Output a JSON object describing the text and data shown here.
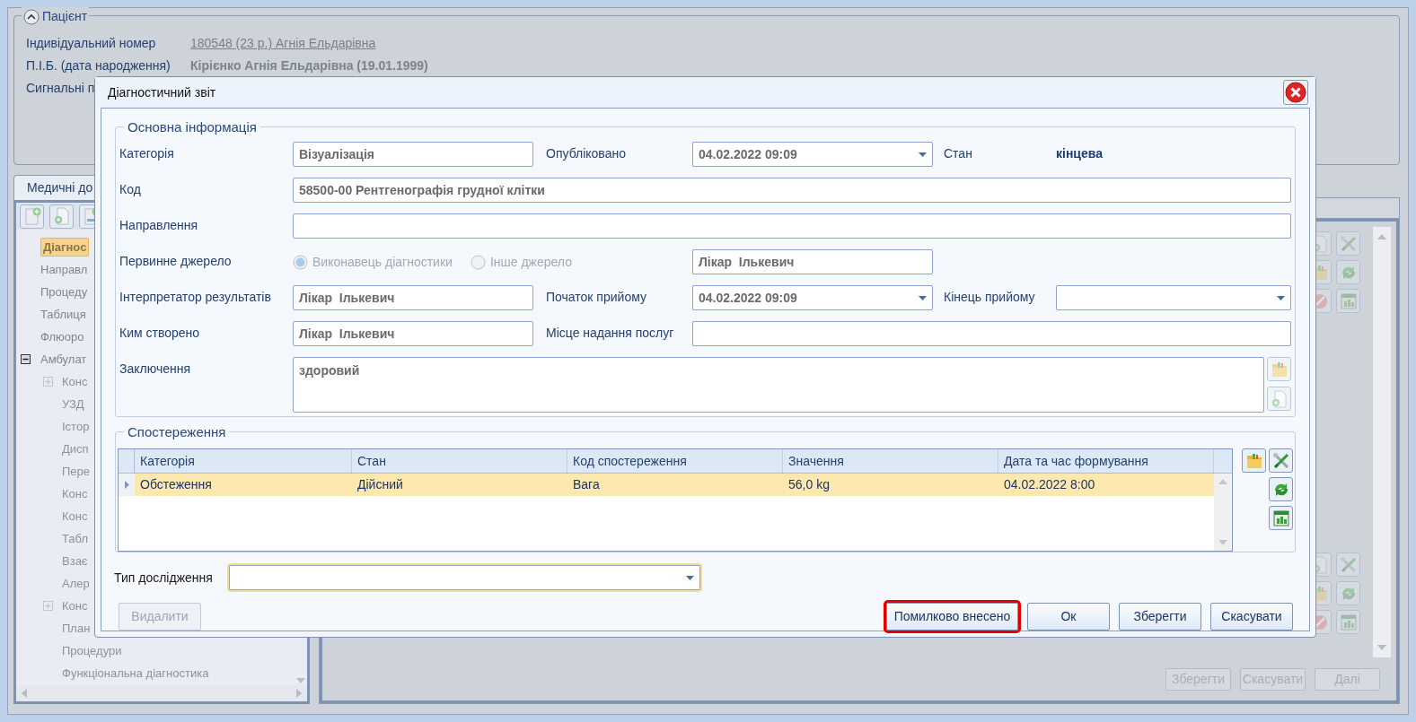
{
  "patient_panel": {
    "title": "Пацієнт",
    "rows": [
      {
        "label": "Індивідуальний номер",
        "value": "180548 (23 р.) Агнія Ельдарівна",
        "kind": "link"
      },
      {
        "label": "П.І.Б. (дата народження)",
        "value": "Кірієнко Агнія Ельдарівна (19.01.1999)",
        "kind": "bold"
      },
      {
        "label": "Сигнальні п",
        "kind": "plain"
      }
    ]
  },
  "records_panel": {
    "tab": "Медичні до",
    "tree": [
      {
        "label": "Діагнос",
        "selected": true,
        "kind": "leaf"
      },
      {
        "label": "Направл",
        "selected": false,
        "kind": "leaf"
      },
      {
        "label": "Процеду",
        "selected": false,
        "kind": "leaf"
      },
      {
        "label": "Таблиця",
        "selected": false,
        "kind": "leaf"
      },
      {
        "label": "Флюоро",
        "selected": false,
        "kind": "leaf"
      },
      {
        "label": "Амбулат",
        "selected": false,
        "kind": "folder",
        "expanded": true,
        "children": [
          {
            "label": "Конс",
            "selected": false,
            "kind": "folder",
            "expanded": false
          },
          {
            "label": "УЗД",
            "selected": false,
            "kind": "leaf"
          },
          {
            "label": "Істор",
            "selected": false,
            "kind": "leaf"
          },
          {
            "label": "Дисп",
            "selected": false,
            "kind": "leaf"
          },
          {
            "label": "Пере",
            "selected": false,
            "kind": "leaf"
          },
          {
            "label": "Конс",
            "selected": false,
            "kind": "leaf"
          },
          {
            "label": "Конс",
            "selected": false,
            "kind": "leaf"
          },
          {
            "label": "Табл",
            "selected": false,
            "kind": "leaf"
          },
          {
            "label": "Взає",
            "selected": false,
            "kind": "leaf"
          },
          {
            "label": "Алер",
            "selected": false,
            "kind": "leaf"
          },
          {
            "label": "Конс",
            "selected": false,
            "kind": "folder",
            "expanded": false
          },
          {
            "label": "План",
            "selected": false,
            "kind": "leaf"
          },
          {
            "label": "Процедури",
            "selected": false,
            "kind": "leaf"
          },
          {
            "label": "Функціональна діагностика",
            "selected": false,
            "kind": "leaf"
          }
        ]
      }
    ]
  },
  "main_buttons": [
    {
      "label": "Зберегти",
      "disabled": true
    },
    {
      "label": "Скасувати",
      "disabled": true
    },
    {
      "label": "Далі",
      "disabled": true
    }
  ],
  "dialog": {
    "title": "Діагностичний звіт",
    "main_info": {
      "title": "Основна інформація",
      "category": {
        "label": "Категорія",
        "value": "Візуалізація"
      },
      "published": {
        "label": "Опубліковано",
        "value": "04.02.2022 09:09"
      },
      "status": {
        "label": "Стан",
        "value": "кінцева"
      },
      "code": {
        "label": "Код",
        "value": "58500-00 Рентгенографія грудної клітки"
      },
      "referral": {
        "label": "Направлення"
      },
      "primary_source": {
        "label": "Первинне джерело",
        "options": [
          {
            "label": "Виконавець діагностики",
            "selected": true,
            "disabled": true
          },
          {
            "label": "Інше джерело",
            "selected": false,
            "disabled": true
          }
        ],
        "value": "Лікар  Ількевич"
      },
      "interpreter": {
        "label": "Інтерпретатор результатів",
        "value": "Лікар  Ількевич"
      },
      "visit_start": {
        "label": "Початок прийому",
        "value": "04.02.2022 09:09"
      },
      "visit_end": {
        "label": "Кінець прийому"
      },
      "created_by": {
        "label": "Ким створено",
        "value": "Лікар  Ількевич"
      },
      "service_location": {
        "label": "Місце надання послуг"
      },
      "conclusion": {
        "label": "Заключення",
        "value": "здоровий"
      }
    },
    "observations": {
      "title": "Спостереження",
      "columns": [
        "Категорія",
        "Стан",
        "Код спостереження",
        "Значення",
        "Дата та час формування"
      ],
      "rows": [
        {
          "cells": [
            "Обстеження",
            "Дійсний",
            "Вага",
            "56,0 kg",
            "04.02.2022 8:00"
          ],
          "selected": true
        }
      ]
    },
    "study_type": {
      "label": "Тип дослідження"
    },
    "buttons": [
      {
        "label": "Видалити",
        "disabled": true,
        "highlighted": false
      },
      {
        "label": "Помилково внесено",
        "disabled": false,
        "highlighted": true
      },
      {
        "label": "Ок",
        "disabled": false,
        "highlighted": false
      },
      {
        "label": "Зберегти",
        "disabled": false,
        "highlighted": false
      },
      {
        "label": "Скасувати",
        "disabled": false,
        "highlighted": false
      }
    ]
  }
}
